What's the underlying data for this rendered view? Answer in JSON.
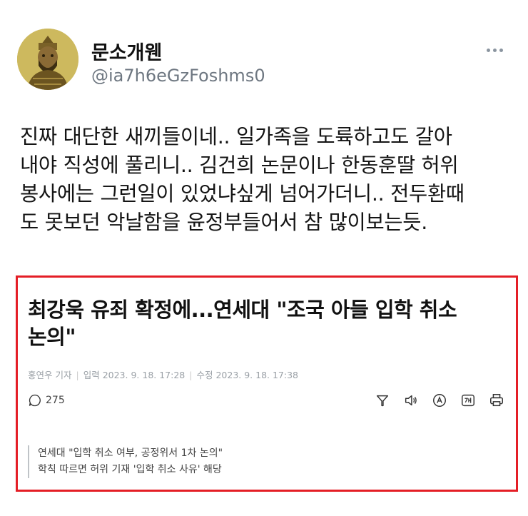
{
  "tweet": {
    "display_name": "문소개웬",
    "handle": "@ia7h6eGzFoshms0",
    "avatar_icon": "warrior-portrait-avatar",
    "more_icon": "more-options-icon",
    "text": "진짜 대단한 새끼들이네.. 일가족을 도륙하고도 갈아\n내야 직성에 풀리니.. 김건희 논문이나 한동훈딸 허위\n봉사에는 그런일이 있었냐싶게 넘어가더니.. 전두환때\n도 못보던 악날함을 윤정부들어서 참 많이보는듯."
  },
  "article": {
    "border_color": "#e41e26",
    "headline": "최강욱 유죄 확정에...연세대 \"조국 아들 입학 취소\n논의\"",
    "reporter": "홍연우 기자",
    "input_label": "입력",
    "input_time": "2023. 9. 18. 17:28",
    "edit_label": "수정",
    "edit_time": "2023. 9. 18. 17:38",
    "comment_count": "275",
    "toolbar_icons": [
      "share-icon",
      "speaker-icon",
      "translate-icon",
      "text-size-icon",
      "print-icon"
    ],
    "subhead": "연세대 \"입학 취소 여부, 공정위서 1차 논의\"\n학칙 따르면 허위 기재 '입학 취소 사유' 해당"
  }
}
